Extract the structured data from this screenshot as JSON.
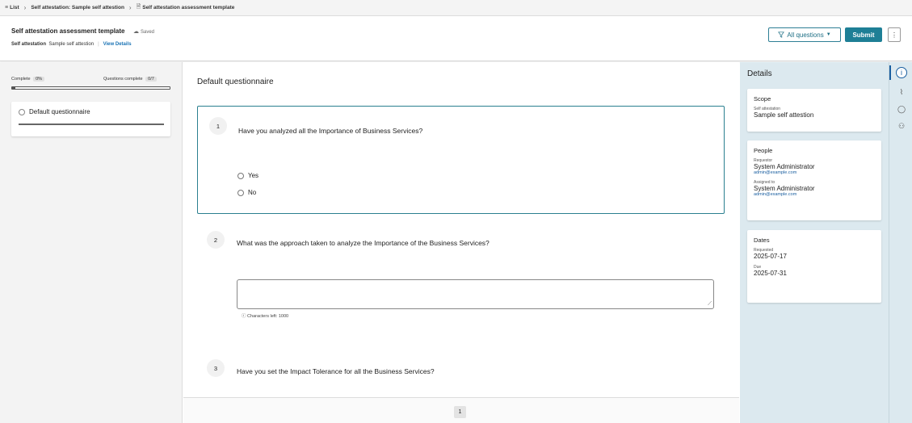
{
  "breadcrumb": {
    "list_icon": "≡",
    "item1": "List",
    "item2": "Self attestation: Sample self attestion",
    "doc_icon": "🗎",
    "item3": "Self attestation assessment template"
  },
  "header": {
    "title": "Self attestation assessment template",
    "saved": "Saved",
    "type_label": "Self attestation",
    "type_value": "Sample self attestion",
    "view_details": "View Details",
    "filter_label": "All questions",
    "submit_label": "Submit",
    "more_label": "⋮"
  },
  "left": {
    "complete_label": "Complete",
    "complete_value": "0%",
    "questions_label": "Questions complete",
    "questions_value": "0/7",
    "progress_fraction": 0.0,
    "section": "Default questionnaire"
  },
  "main": {
    "title": "Default questionnaire",
    "questions": [
      {
        "num": "1",
        "text": "Have you analyzed all the Importance of Business Services?",
        "options": [
          "Yes",
          "No"
        ]
      },
      {
        "num": "2",
        "text": "What was the approach taken to analyze the Importance of the Business Services?",
        "chars_left": "Characters left: 1000"
      },
      {
        "num": "3",
        "text": "Have you set the Impact Tolerance for all the Business Services?"
      }
    ],
    "page": "1"
  },
  "details": {
    "title": "Details",
    "scope": {
      "title": "Scope",
      "label": "Self attestation",
      "value": "Sample self attestion"
    },
    "people": {
      "title": "People",
      "requestor_label": "Requestor",
      "requestor_name": "System Administrator",
      "requestor_email": "admin@example.com",
      "assigned_label": "Assigned to",
      "assigned_name": "System Administrator",
      "assigned_email": "admin@example.com"
    },
    "dates": {
      "title": "Dates",
      "requested_label": "Requested",
      "requested": "2025-07-17",
      "due_label": "Due",
      "due": "2025-07-31"
    }
  },
  "rail": {
    "icons": [
      "info-icon",
      "paperclip-icon",
      "comment-icon",
      "people-icon"
    ]
  }
}
